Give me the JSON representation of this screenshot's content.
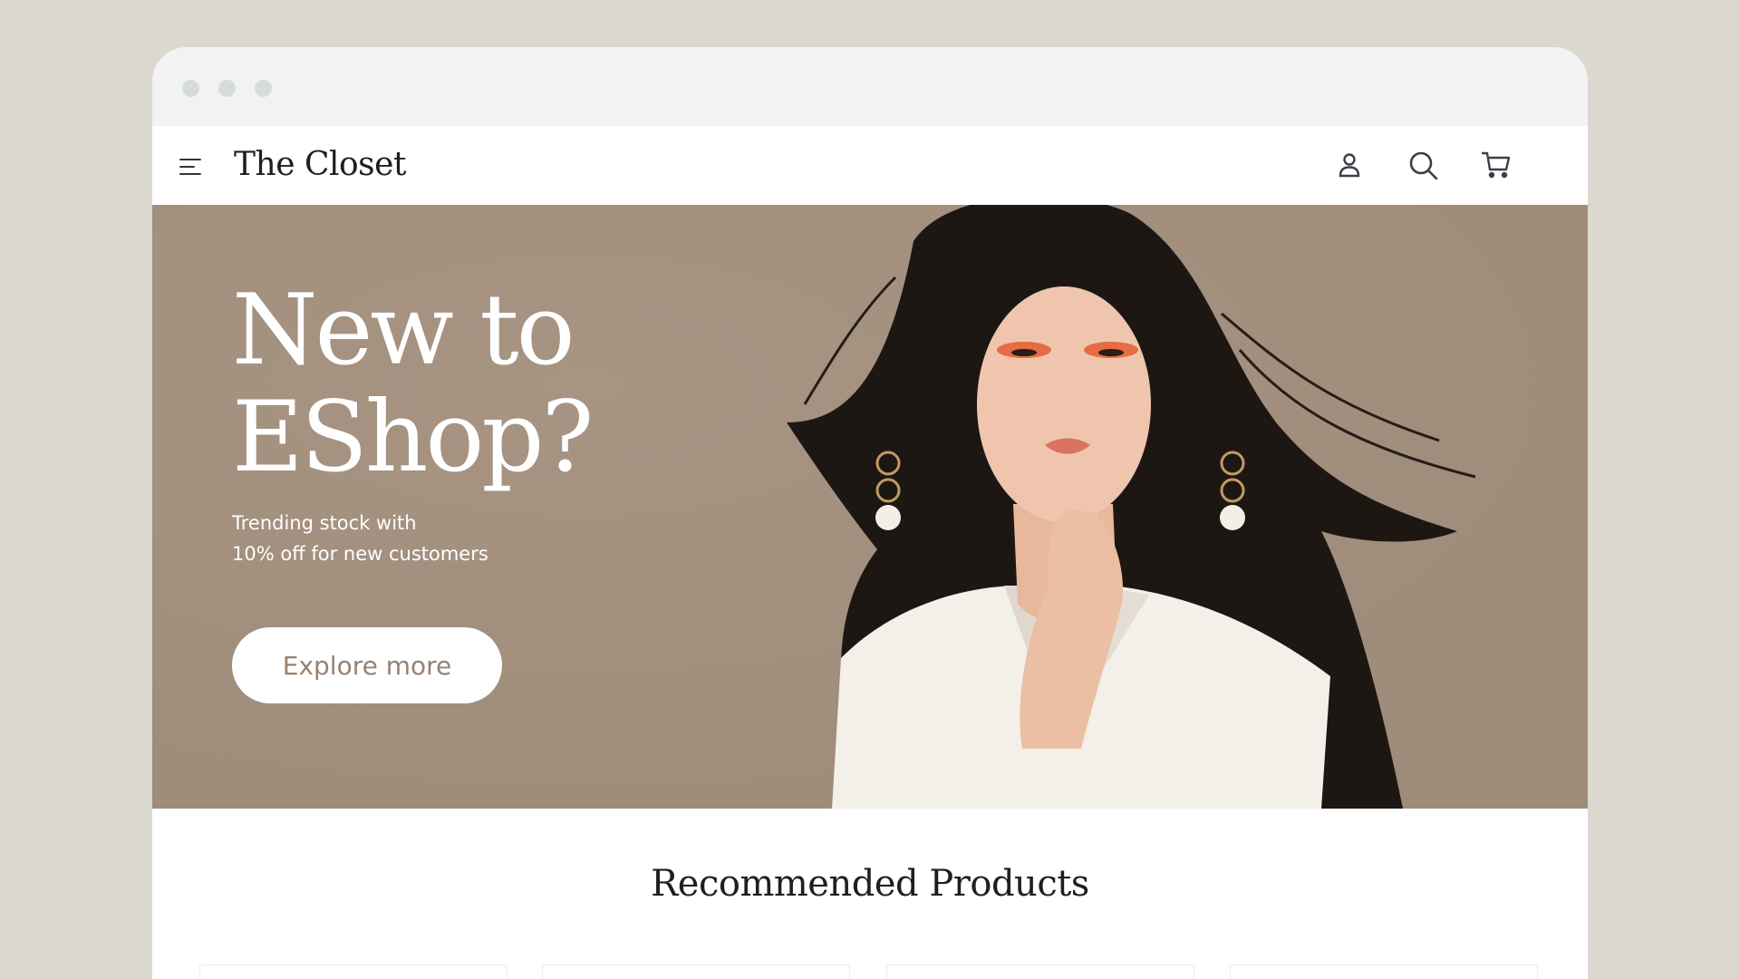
{
  "window": {
    "controls": [
      "dot-1",
      "dot-2",
      "dot-3"
    ]
  },
  "header": {
    "brand": "The Closet",
    "menu_icon": "hamburger-menu-icon",
    "icons": [
      "user-icon",
      "search-icon",
      "cart-icon"
    ]
  },
  "hero": {
    "title": "New to EShop?",
    "subtitle_line1": "Trending stock with",
    "subtitle_line2": "10% off for new customers",
    "button_label": "Explore more",
    "background_color": "#a38f7e"
  },
  "recommended": {
    "title": "Recommended Products",
    "product_cards": 4
  },
  "colors": {
    "page_bg": "#dbd8d0",
    "button_text": "#9a8170",
    "brand_text": "#1f1f1f"
  }
}
